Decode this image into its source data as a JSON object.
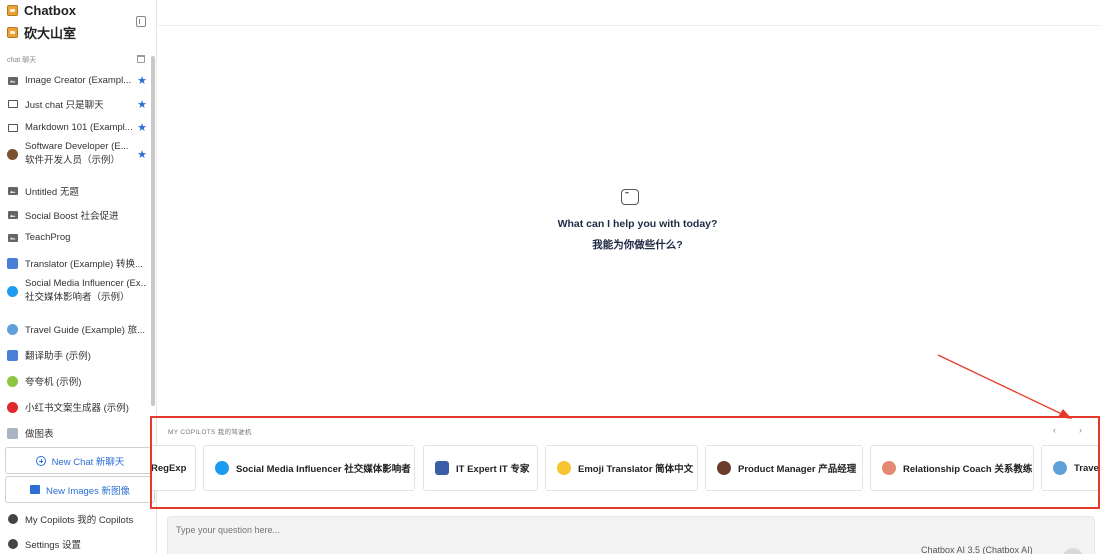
{
  "app": {
    "brand_primary": "Chatbox",
    "brand_secondary": "砍大山室"
  },
  "sidebar": {
    "section_label": "chat 聊天",
    "sessions": [
      {
        "label": "Image Creator (Exampl...",
        "icon": "image-icon",
        "starred": true
      },
      {
        "label": "Just chat  只是聊天",
        "icon": "chat-icon",
        "starred": true
      },
      {
        "label": "Markdown 101 (Exampl...",
        "icon": "chat-icon",
        "starred": true
      },
      {
        "label_line1": "Software Developer (E...",
        "label_line2": "软件开发人员（示例）",
        "icon": "avatar-icon",
        "starred": true
      },
      {
        "label": "Untitled  无题",
        "icon": "image-icon",
        "starred": false
      },
      {
        "label": "Social Boost  社会促进",
        "icon": "image-icon",
        "starred": false
      },
      {
        "label": "TeachProg",
        "icon": "image-icon",
        "starred": false
      },
      {
        "label": "Translator (Example)  转换...",
        "icon": "translate-icon",
        "starred": false
      },
      {
        "label_line1": "Social Media Influencer (Ex...",
        "label_line2": "社交媒体影响者（示例）",
        "icon": "twitter-icon",
        "starred": false
      },
      {
        "label": "Travel Guide (Example)  旅...",
        "icon": "globe-icon",
        "starred": false
      },
      {
        "label": "翻译助手 (示例)",
        "icon": "translate-icon",
        "starred": false
      },
      {
        "label": "夸夸机 (示例)",
        "icon": "sparkle-icon",
        "starred": false
      },
      {
        "label": "小红书文案生成器 (示例)",
        "icon": "redbook-icon",
        "starred": false
      },
      {
        "label": "做图表",
        "icon": "chart-icon",
        "starred": false
      }
    ],
    "new_chat": "New Chat  新聊天",
    "new_images": "New Images  新图像",
    "my_copilots": "My Copilots  我的 Copilots",
    "settings": "Settings  设置"
  },
  "main": {
    "welcome_en": "What can I help you with today?",
    "welcome_zh": "我能为你做些什么?"
  },
  "copilots": {
    "label": "MY COPILOTS  我的驾驶机",
    "prev": "‹",
    "next": "›",
    "cards": [
      {
        "label": "RegExp",
        "icon": "none"
      },
      {
        "label": "Social Media Influencer  社交媒体影响者",
        "icon": "twitter-icon"
      },
      {
        "label": "IT Expert  IT 专家",
        "icon": "monitor-icon"
      },
      {
        "label": "Emoji Translator  简体中文",
        "icon": "emoji-icon"
      },
      {
        "label": "Product Manager  产品经理",
        "icon": "person-icon"
      },
      {
        "label": "Relationship Coach  关系教练",
        "icon": "hands-icon"
      },
      {
        "label": "Travel",
        "icon": "globe-icon"
      }
    ]
  },
  "input": {
    "placeholder": "Type your question here...",
    "model": "Chatbox AI 3.5 (Chatbox AI)"
  },
  "colors": {
    "accent": "#2c6fd6",
    "annotation": "#e53a2b"
  }
}
